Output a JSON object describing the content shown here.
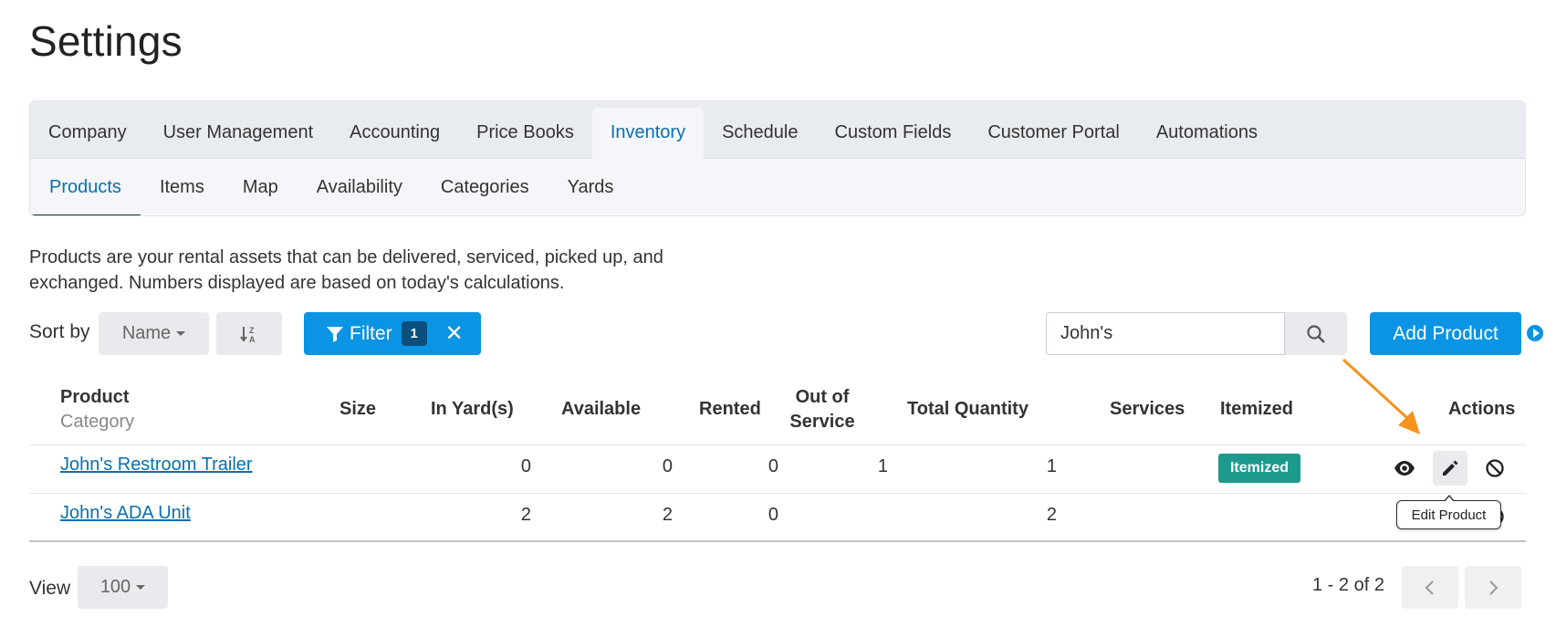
{
  "page": {
    "title": "Settings"
  },
  "main_tabs": [
    {
      "label": "Company"
    },
    {
      "label": "User Management"
    },
    {
      "label": "Accounting"
    },
    {
      "label": "Price Books"
    },
    {
      "label": "Inventory",
      "active": true
    },
    {
      "label": "Schedule"
    },
    {
      "label": "Custom Fields"
    },
    {
      "label": "Customer Portal"
    },
    {
      "label": "Automations"
    }
  ],
  "sub_tabs": [
    {
      "label": "Products",
      "active": true
    },
    {
      "label": "Items"
    },
    {
      "label": "Map"
    },
    {
      "label": "Availability"
    },
    {
      "label": "Categories"
    },
    {
      "label": "Yards"
    }
  ],
  "description": "Products are your rental assets that can be delivered, serviced, picked up, and exchanged. Numbers displayed are based on today's calculations.",
  "toolbar": {
    "sort_label": "Sort by",
    "sort_value": "Name",
    "filter_label": "Filter",
    "filter_count": "1",
    "search_value": "John's",
    "add_label": "Add Product"
  },
  "table": {
    "headers": {
      "product": "Product",
      "category": "Category",
      "size": "Size",
      "in_yards": "In Yard(s)",
      "available": "Available",
      "rented": "Rented",
      "out_of_service_1": "Out of",
      "out_of_service_2": "Service",
      "total_quantity": "Total Quantity",
      "services": "Services",
      "itemized": "Itemized",
      "actions": "Actions"
    },
    "rows": [
      {
        "product": "John's Restroom Trailer",
        "size": "",
        "in_yards": "0",
        "available": "0",
        "rented": "0",
        "out_of_service": "1",
        "total_quantity": "1",
        "services": "",
        "itemized": "Itemized"
      },
      {
        "product": "John's ADA Unit",
        "size": "",
        "in_yards": "2",
        "available": "2",
        "rented": "0",
        "out_of_service": "",
        "total_quantity": "2",
        "services": "",
        "itemized": ""
      }
    ]
  },
  "tooltip": {
    "text": "Edit Product"
  },
  "footer": {
    "view_label": "View",
    "view_value": "100",
    "pager_text": "1 - 2 of 2"
  },
  "colors": {
    "primary": "#0b94e3",
    "link": "#0a6fb0",
    "itemized": "#1c9a8e",
    "arrow": "#f5921e"
  },
  "icons": [
    "sort-alpha-desc-icon",
    "filter-icon",
    "close-icon",
    "search-icon",
    "play-circle-icon",
    "eye-icon",
    "pencil-icon",
    "ban-icon",
    "chevron-left-icon",
    "chevron-right-icon"
  ]
}
